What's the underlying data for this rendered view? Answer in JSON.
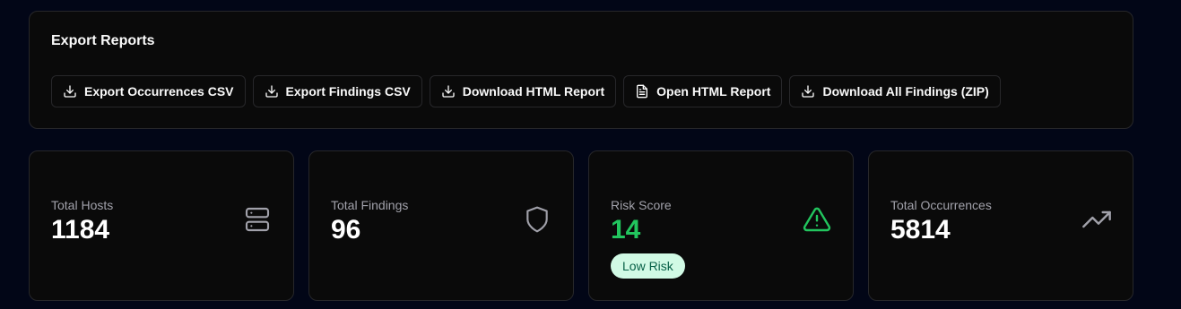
{
  "export": {
    "title": "Export Reports",
    "buttons": [
      {
        "label": "Export Occurrences CSV",
        "icon": "download-icon"
      },
      {
        "label": "Export Findings CSV",
        "icon": "download-icon"
      },
      {
        "label": "Download HTML Report",
        "icon": "download-icon"
      },
      {
        "label": "Open HTML Report",
        "icon": "file-text-icon"
      },
      {
        "label": "Download All Findings (ZIP)",
        "icon": "download-icon"
      }
    ]
  },
  "stats": [
    {
      "label": "Total Hosts",
      "value": "1184",
      "icon": "server-icon"
    },
    {
      "label": "Total Findings",
      "value": "96",
      "icon": "shield-icon"
    },
    {
      "label": "Risk Score",
      "value": "14",
      "icon": "alert-triangle-icon",
      "value_color": "#22c55e",
      "badge": "Low Risk"
    },
    {
      "label": "Total Occurrences",
      "value": "5814",
      "icon": "trending-up-icon"
    }
  ],
  "colors": {
    "background": "#020617",
    "card": "#0a0a0a",
    "border": "#27272a",
    "risk_accent": "#22c55e",
    "badge_bg": "#d1fae5",
    "badge_text": "#065f46"
  }
}
